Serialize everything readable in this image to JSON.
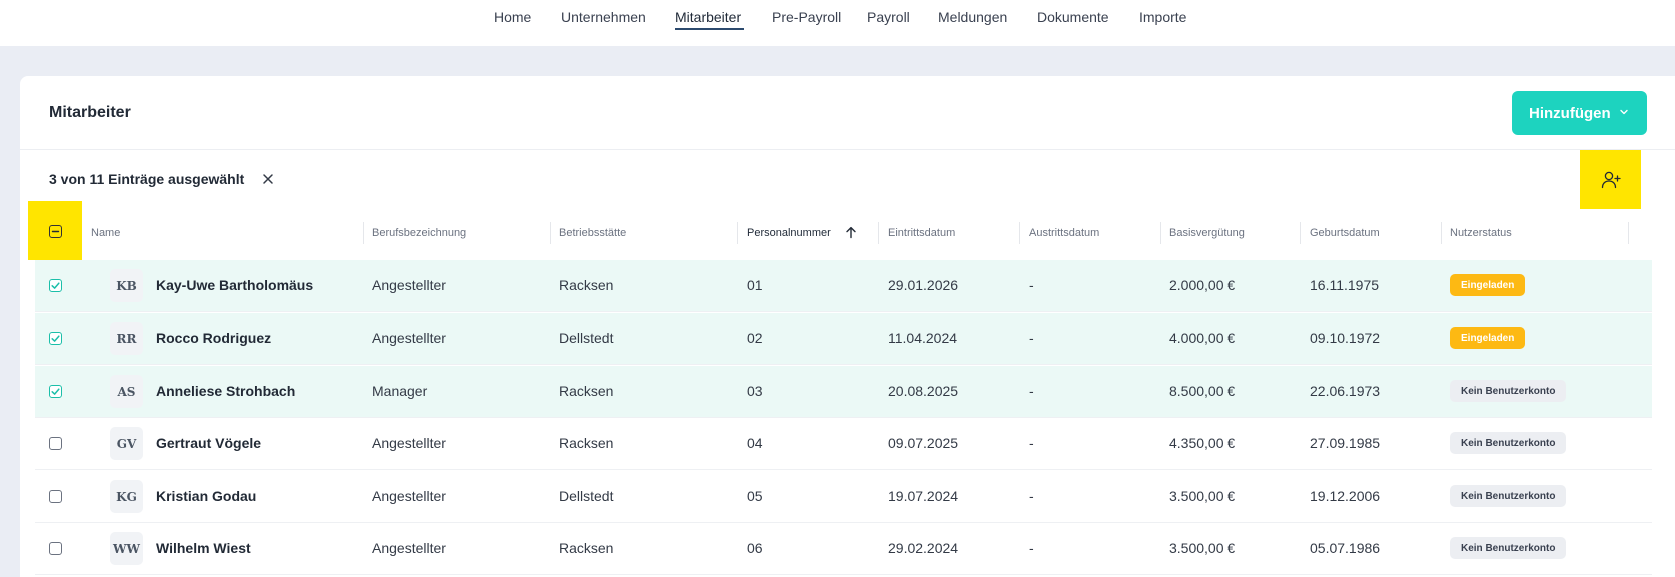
{
  "nav": {
    "items": [
      {
        "label": "Home",
        "active": false
      },
      {
        "label": "Unternehmen",
        "active": false
      },
      {
        "label": "Mitarbeiter",
        "active": true
      },
      {
        "label": "Pre-Payroll",
        "active": false
      },
      {
        "label": "Payroll",
        "active": false
      },
      {
        "label": "Meldungen",
        "active": false
      },
      {
        "label": "Dokumente",
        "active": false
      },
      {
        "label": "Importe",
        "active": false
      }
    ]
  },
  "page": {
    "title": "Mitarbeiter",
    "add_button": "Hinzufügen",
    "selection_text": "3 von 11 Einträge ausgewählt",
    "colors": {
      "accent": "#1dd3bf",
      "highlight": "#ffe500",
      "selected_row": "#ebf9f6",
      "invited": "#fdb913"
    }
  },
  "table": {
    "columns": [
      "Name",
      "Berufsbezeichnung",
      "Betriebsstätte",
      "Personalnummer",
      "Eintrittsdatum",
      "Austrittsdatum",
      "Basisvergütung",
      "Geburtsdatum",
      "Nutzerstatus"
    ],
    "sorted_column": "Personalnummer",
    "sort_direction": "ascending",
    "header_checkbox_state": "indeterminate",
    "rows": [
      {
        "initials": "KB",
        "name": "Kay-Uwe Bartholomäus",
        "job": "Angestellter",
        "site": "Racksen",
        "number": "01",
        "entry": "29.01.2026",
        "exit": "-",
        "salary": "2.000,00 €",
        "birth": "16.11.1975",
        "status": "Eingeladen",
        "status_type": "invited",
        "selected": true
      },
      {
        "initials": "RR",
        "name": "Rocco Rodriguez",
        "job": "Angestellter",
        "site": "Dellstedt",
        "number": "02",
        "entry": "11.04.2024",
        "exit": "-",
        "salary": "4.000,00 €",
        "birth": "09.10.1972",
        "status": "Eingeladen",
        "status_type": "invited",
        "selected": true
      },
      {
        "initials": "AS",
        "name": "Anneliese Strohbach",
        "job": "Manager",
        "site": "Racksen",
        "number": "03",
        "entry": "20.08.2025",
        "exit": "-",
        "salary": "8.500,00 €",
        "birth": "22.06.1973",
        "status": "Kein Benutzerkonto",
        "status_type": "none",
        "selected": true
      },
      {
        "initials": "GV",
        "name": "Gertraut Vögele",
        "job": "Angestellter",
        "site": "Racksen",
        "number": "04",
        "entry": "09.07.2025",
        "exit": "-",
        "salary": "4.350,00 €",
        "birth": "27.09.1985",
        "status": "Kein Benutzerkonto",
        "status_type": "none",
        "selected": false
      },
      {
        "initials": "KG",
        "name": "Kristian Godau",
        "job": "Angestellter",
        "site": "Dellstedt",
        "number": "05",
        "entry": "19.07.2024",
        "exit": "-",
        "salary": "3.500,00 €",
        "birth": "19.12.2006",
        "status": "Kein Benutzerkonto",
        "status_type": "none",
        "selected": false
      },
      {
        "initials": "WW",
        "name": "Wilhelm Wiest",
        "job": "Angestellter",
        "site": "Racksen",
        "number": "06",
        "entry": "29.02.2024",
        "exit": "-",
        "salary": "3.500,00 €",
        "birth": "05.07.1986",
        "status": "Kein Benutzerkonto",
        "status_type": "none",
        "selected": false
      }
    ]
  }
}
